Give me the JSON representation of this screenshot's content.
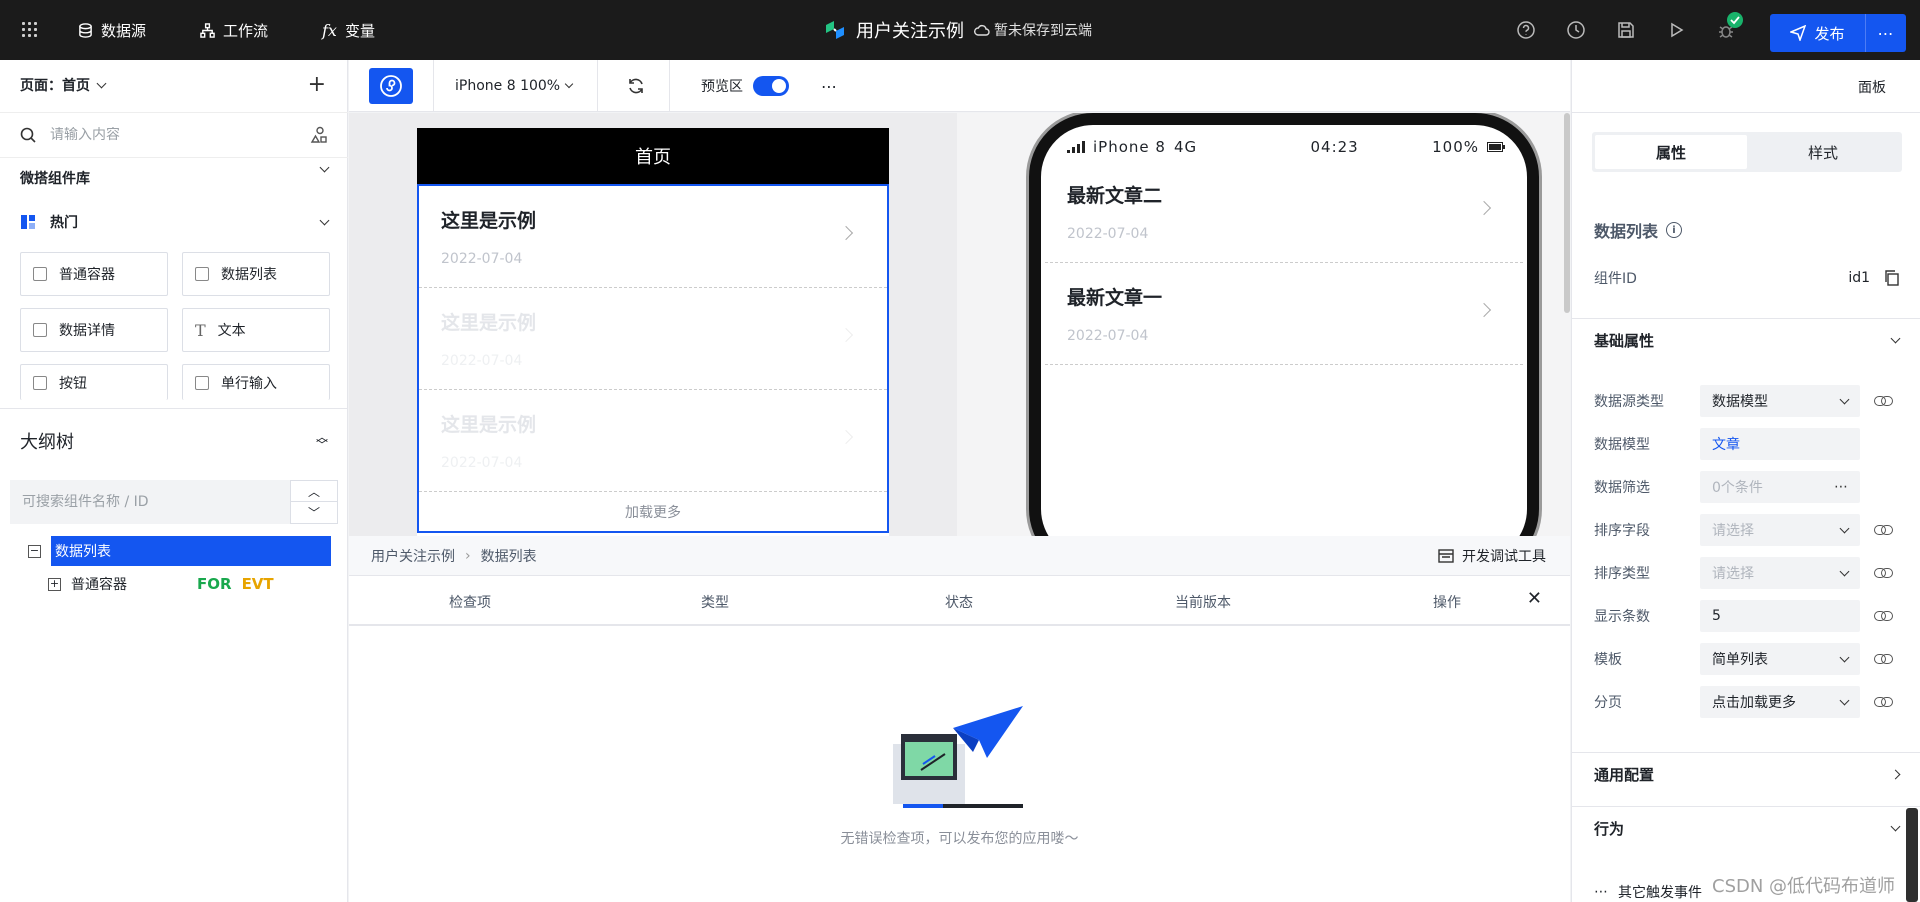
{
  "topbar": {
    "datasource": "数据源",
    "workflow": "工作流",
    "variables": "变量",
    "app_title": "用户关注示例",
    "save_status": "暂未保存到云端",
    "publish": "发布"
  },
  "left": {
    "page_label": "页面：首页",
    "search_placeholder": "请输入内容",
    "library_title": "微搭组件库",
    "hot_title": "热门",
    "components": [
      "普通容器",
      "数据列表",
      "数据详情",
      "文本",
      "按钮",
      "单行输入"
    ],
    "outline_title": "大纲树",
    "outline_search_placeholder": "可搜索组件名称 / ID",
    "tree": [
      {
        "label": "数据列表",
        "selected": true
      },
      {
        "label": "普通容器",
        "tags": [
          "FOR",
          "EVT"
        ]
      }
    ]
  },
  "toolbar": {
    "device": "iPhone 8 100%",
    "preview_label": "预览区",
    "preview_on": true,
    "panel_label": "面板"
  },
  "editor": {
    "page_header": "首页",
    "items": [
      {
        "title": "这里是示例",
        "date": "2022-07-04"
      },
      {
        "title": "这里是示例",
        "date": "2022-07-04"
      },
      {
        "title": "这里是示例",
        "date": "2022-07-04"
      }
    ],
    "load_more": "加载更多"
  },
  "phone": {
    "carrier": "iPhone 8",
    "network": "4G",
    "time": "04:23",
    "battery": "100%",
    "items": [
      {
        "title": "最新文章二",
        "date": "2022-07-04"
      },
      {
        "title": "最新文章一",
        "date": "2022-07-04"
      }
    ]
  },
  "debug": {
    "crumb": [
      "用户关注示例",
      "数据列表"
    ],
    "dev_tools": "开发调试工具",
    "columns": [
      "检查项",
      "类型",
      "状态",
      "当前版本",
      "操作"
    ],
    "empty_text": "无错误检查项，可以发布您的应用喽～"
  },
  "right": {
    "tabs": [
      "属性",
      "样式"
    ],
    "component_name": "数据列表",
    "id_label": "组件ID",
    "id_value": "id1",
    "basic_section": "基础属性",
    "props": [
      {
        "label": "数据源类型",
        "value": "数据模型",
        "kind": "select"
      },
      {
        "label": "数据模型",
        "value": "文章",
        "kind": "link"
      },
      {
        "label": "数据筛选",
        "value": "0个条件",
        "kind": "more"
      },
      {
        "label": "排序字段",
        "value": "请选择",
        "kind": "select-ph"
      },
      {
        "label": "排序类型",
        "value": "请选择",
        "kind": "select-ph"
      },
      {
        "label": "显示条数",
        "value": "5",
        "kind": "input"
      },
      {
        "label": "模板",
        "value": "简单列表",
        "kind": "select"
      },
      {
        "label": "分页",
        "value": "点击加载更多",
        "kind": "select"
      }
    ],
    "general_section": "通用配置",
    "behavior_section": "行为",
    "other_events": "其它触发事件"
  },
  "watermark": "CSDN @低代码布道师",
  "colors": {
    "accent": "#1456f0",
    "topbar": "#1b1b1b",
    "ok": "#19b36b",
    "for_tag": "#19a84d",
    "evt_tag": "#e7a400"
  }
}
